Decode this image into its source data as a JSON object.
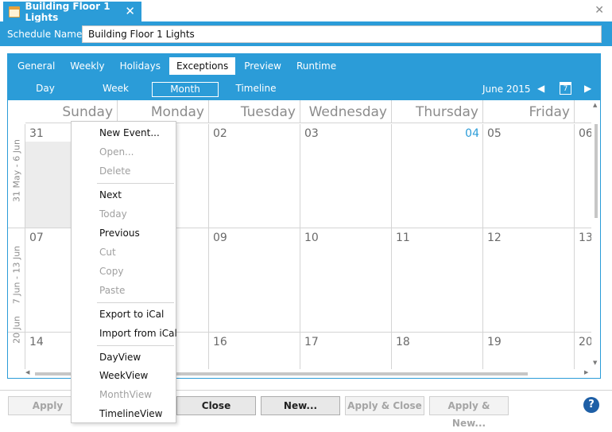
{
  "window": {
    "tab_title": "Building Floor 1 Lights",
    "tab_close_glyph": "✕",
    "window_close_glyph": "✕"
  },
  "header": {
    "label": "Schedule  Name:",
    "name_value": "Building Floor 1 Lights"
  },
  "tabs": [
    {
      "label": "General"
    },
    {
      "label": "Weekly"
    },
    {
      "label": "Holidays"
    },
    {
      "label": "Exceptions",
      "active": true
    },
    {
      "label": "Preview"
    },
    {
      "label": "Runtime"
    }
  ],
  "view_tabs": [
    {
      "label": "Day"
    },
    {
      "label": "Week"
    },
    {
      "label": "Month",
      "active": true
    },
    {
      "label": "Timeline"
    }
  ],
  "navigator": {
    "month_label": "June 2015",
    "prev_glyph": "◀",
    "next_glyph": "▶",
    "calendar_icon_text": "7"
  },
  "calendar": {
    "day_headers": [
      "Sunday",
      "Monday",
      "Tuesday",
      "Wednesday",
      "Thursday",
      "Friday"
    ],
    "weeks": [
      {
        "label": "31 May - 6 Jun",
        "days": [
          "31",
          "",
          "02",
          "03",
          "04",
          "05",
          "06"
        ]
      },
      {
        "label": "7 Jun - 13 Jun",
        "days": [
          "07",
          "",
          "09",
          "10",
          "11",
          "12",
          "13"
        ]
      },
      {
        "label": "20 Jun",
        "days": [
          "14",
          "",
          "16",
          "17",
          "18",
          "19",
          "20"
        ]
      }
    ],
    "today": "04"
  },
  "context_menu": {
    "items": [
      {
        "label": "New Event...",
        "enabled": true
      },
      {
        "label": "Open...",
        "enabled": false
      },
      {
        "label": "Delete",
        "enabled": false
      },
      {
        "label": "Next",
        "enabled": true
      },
      {
        "label": "Today",
        "enabled": false
      },
      {
        "label": "Previous",
        "enabled": true
      },
      {
        "label": "Cut",
        "enabled": false
      },
      {
        "label": "Copy",
        "enabled": false
      },
      {
        "label": "Paste",
        "enabled": false
      },
      {
        "label": "Export to iCal",
        "enabled": true
      },
      {
        "label": "Import from iCal",
        "enabled": true
      },
      {
        "label": "DayView",
        "enabled": true
      },
      {
        "label": "WeekView",
        "enabled": true
      },
      {
        "label": "MonthView",
        "enabled": false
      },
      {
        "label": "TimelineView",
        "enabled": true
      }
    ]
  },
  "buttons": {
    "apply": "Apply",
    "close": "Close",
    "new": "New...",
    "apply_close": "Apply & Close",
    "apply_new": "Apply & New...",
    "help": "?"
  },
  "colors": {
    "accent": "#2b9cd8",
    "today_text": "#2b9cd8",
    "disabled_text": "#a0a0a0",
    "help_button": "#1e5fa6"
  }
}
